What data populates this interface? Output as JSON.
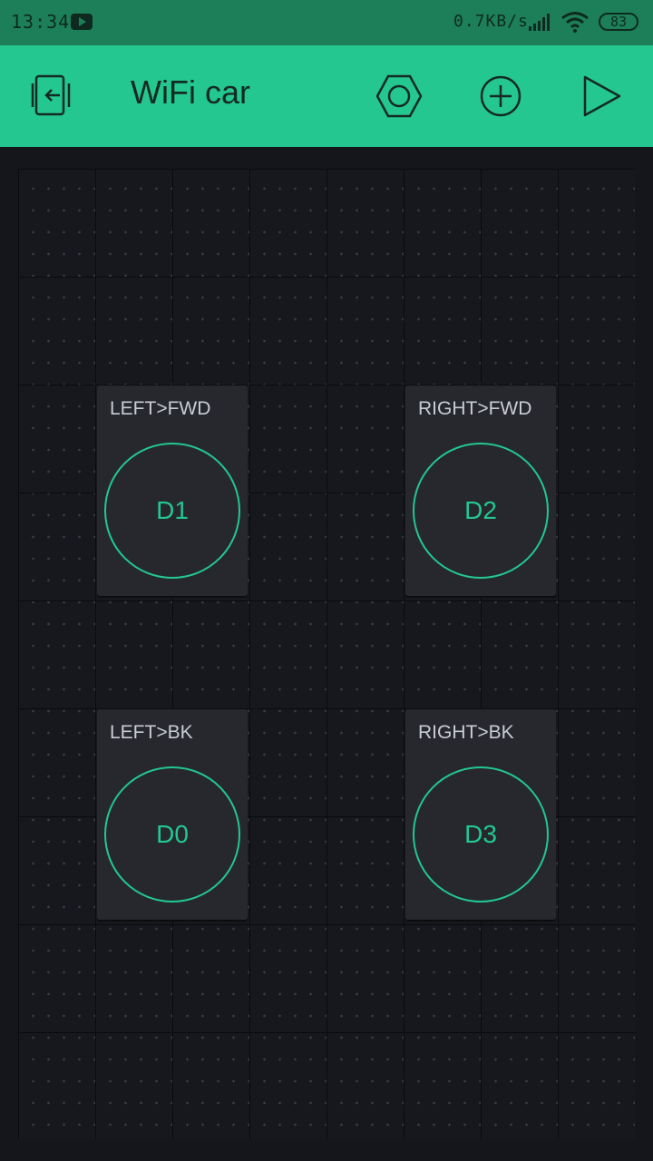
{
  "status_bar": {
    "time": "13:34",
    "net_speed": "0.7KB/s",
    "battery": "83"
  },
  "toolbar": {
    "title": "WiFi car"
  },
  "widgets": [
    {
      "label": "LEFT>FWD",
      "pin": "D1"
    },
    {
      "label": "RIGHT>FWD",
      "pin": "D2"
    },
    {
      "label": "LEFT>BK",
      "pin": "D0"
    },
    {
      "label": "RIGHT>BK",
      "pin": "D3"
    }
  ],
  "colors": {
    "accent": "#23c78f",
    "status_bar": "#1d7f5a",
    "background": "#15161b",
    "widget": "#26282e"
  },
  "icons": {
    "status_bar": [
      "youtube-icon",
      "signal-icon",
      "wifi-icon",
      "battery-icon"
    ],
    "toolbar": [
      "exit-icon",
      "settings-icon",
      "add-icon",
      "play-icon"
    ]
  }
}
